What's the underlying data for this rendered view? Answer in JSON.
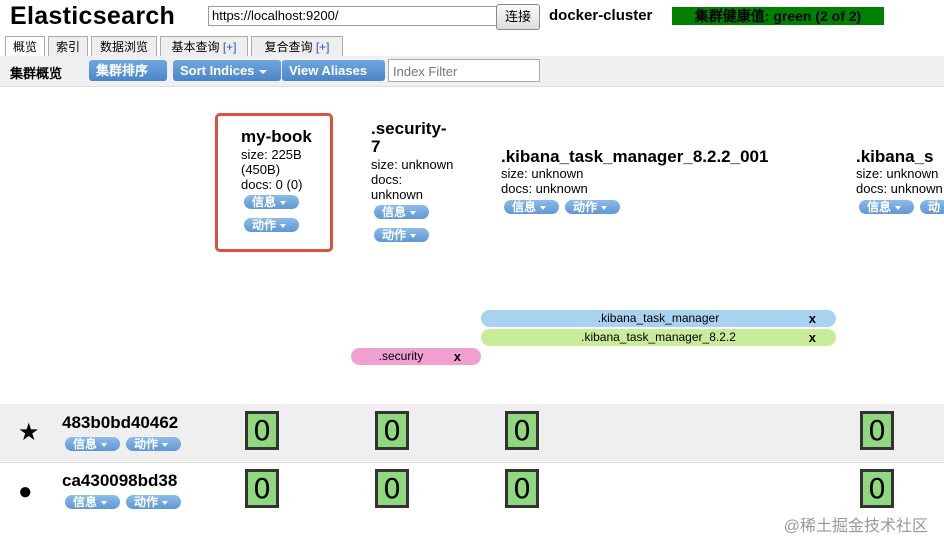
{
  "header": {
    "app_title": "Elasticsearch",
    "url": "https://localhost:9200/",
    "connect_label": "连接",
    "cluster_name": "docker-cluster",
    "health": "集群健康值: green (2 of 2)",
    "health_color": "#008000"
  },
  "tabs": [
    {
      "label": "概览",
      "extra": ""
    },
    {
      "label": "索引",
      "extra": ""
    },
    {
      "label": "数据浏览",
      "extra": ""
    },
    {
      "label": "基本查询 ",
      "extra": "[+]"
    },
    {
      "label": "复合查询 ",
      "extra": "[+]"
    }
  ],
  "toolbar": {
    "title": "集群概览",
    "sort_label": "集群排序",
    "sort_indices_label": "Sort Indices",
    "view_aliases_label": "View Aliases",
    "filter_placeholder": "Index Filter"
  },
  "pill_labels": {
    "info": "信息",
    "action": "动作"
  },
  "indices": [
    {
      "name": "my-book",
      "size": "size: 225B",
      "size_extra": "(450B)",
      "docs": "docs: 0 (0)"
    },
    {
      "name_l1": ".security-",
      "name_l2": "7",
      "size": "size: unknown",
      "docs_l1": "docs:",
      "docs_l2": "unknown"
    },
    {
      "name": ".kibana_task_manager_8.2.2_001",
      "size": "size: unknown",
      "docs": "docs: unknown"
    },
    {
      "name": ".kibana_s",
      "size": "size: unknown",
      "docs": "docs: unknown"
    }
  ],
  "aliases": [
    {
      "name": ".kibana_task_manager",
      "close": "x",
      "color": "#a9d1f0"
    },
    {
      "name": ".kibana_task_manager_8.2.2",
      "close": "x",
      "color": "#c9ec98"
    },
    {
      "name": ".security",
      "close": "x",
      "color": "#f09fd0"
    }
  ],
  "nodes": [
    {
      "icon": "★",
      "name": "483b0bd40462",
      "shards": [
        "0",
        "0",
        "0",
        "0"
      ]
    },
    {
      "icon": "●",
      "name": "ca430098bd38",
      "shards": [
        "0",
        "0",
        "0",
        "0"
      ]
    }
  ],
  "watermark": "@稀土掘金技术社区"
}
